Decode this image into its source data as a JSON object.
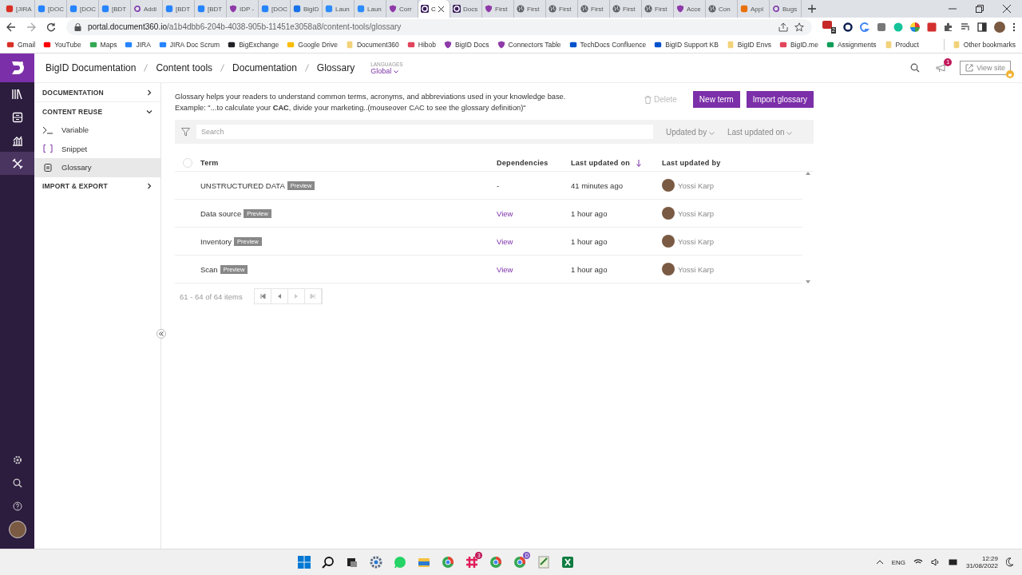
{
  "browser": {
    "tabs": [
      {
        "kind": "gmail",
        "label": "[JIRA",
        "selected": false
      },
      {
        "kind": "jira",
        "label": "[DOC",
        "selected": false
      },
      {
        "kind": "jira",
        "label": "[DOC",
        "selected": false
      },
      {
        "kind": "jira",
        "label": "[BDT",
        "selected": false
      },
      {
        "kind": "ring",
        "label": "Addi",
        "selected": false
      },
      {
        "kind": "jira",
        "label": "[BDT",
        "selected": false
      },
      {
        "kind": "jira",
        "label": "[BDT",
        "selected": false
      },
      {
        "kind": "shield",
        "label": "IDP -",
        "selected": false
      },
      {
        "kind": "jira",
        "label": "[DOC",
        "selected": false
      },
      {
        "kind": "doc",
        "label": "BigID",
        "selected": false
      },
      {
        "kind": "zoom",
        "label": "Laun",
        "selected": false
      },
      {
        "kind": "zoom",
        "label": "Laun",
        "selected": false
      },
      {
        "kind": "shield",
        "label": "Corr",
        "selected": false
      },
      {
        "kind": "d360",
        "label": "C",
        "selected": true
      },
      {
        "kind": "d360",
        "label": "Docs",
        "selected": false
      },
      {
        "kind": "shield",
        "label": "First",
        "selected": false
      },
      {
        "kind": "globe",
        "label": "First",
        "selected": false
      },
      {
        "kind": "globe",
        "label": "First",
        "selected": false
      },
      {
        "kind": "globe",
        "label": "First",
        "selected": false
      },
      {
        "kind": "globe",
        "label": "First",
        "selected": false
      },
      {
        "kind": "globe",
        "label": "First",
        "selected": false
      },
      {
        "kind": "shield",
        "label": "Acce",
        "selected": false
      },
      {
        "kind": "globe",
        "label": "Con",
        "selected": false
      },
      {
        "kind": "app",
        "label": "Appl",
        "selected": false
      },
      {
        "kind": "ring",
        "label": "Bugs",
        "selected": false
      }
    ],
    "url_host": "portal.document360.io",
    "url_path": "/a1b4dbb6-204b-4038-905b-11451e3058a8/content-tools/glossary",
    "extension_badge": "2",
    "bookmarks": [
      {
        "kind": "gmail",
        "label": "Gmail"
      },
      {
        "kind": "youtube",
        "label": "YouTube"
      },
      {
        "kind": "maps",
        "label": "Maps"
      },
      {
        "kind": "jira",
        "label": "JIRA"
      },
      {
        "kind": "jira",
        "label": "JIRA Doc Scrum"
      },
      {
        "kind": "github",
        "label": "BigExchange"
      },
      {
        "kind": "drive",
        "label": "Google Drive"
      },
      {
        "kind": "folder",
        "label": "Document360"
      },
      {
        "kind": "hibob",
        "label": "Hibob"
      },
      {
        "kind": "shield",
        "label": "BigID Docs"
      },
      {
        "kind": "shield",
        "label": "Connectors Table"
      },
      {
        "kind": "confluence",
        "label": "TechDocs Confluence"
      },
      {
        "kind": "confluence",
        "label": "BigID Support KB"
      },
      {
        "kind": "folder",
        "label": "BigID Envs"
      },
      {
        "kind": "dash",
        "label": "BigID.me"
      },
      {
        "kind": "sheet",
        "label": "Assignments"
      },
      {
        "kind": "folder",
        "label": "Product"
      }
    ],
    "other_bookmarks": "Other bookmarks"
  },
  "header": {
    "breadcrumbs": [
      "BigID Documentation",
      "Content tools",
      "Documentation",
      "Glossary"
    ],
    "languages_label": "LANGUAGES",
    "language": "Global",
    "notification_count": "1",
    "view_site": "View site"
  },
  "sidebar": {
    "sections": [
      {
        "label": "DOCUMENTATION",
        "expanded": false
      },
      {
        "label": "CONTENT REUSE",
        "expanded": true,
        "items": [
          {
            "kind": "variable",
            "label": "Variable",
            "selected": false
          },
          {
            "kind": "snippet",
            "label": "Snippet",
            "selected": false
          },
          {
            "kind": "glossary",
            "label": "Glossary",
            "selected": true
          }
        ]
      },
      {
        "label": "IMPORT & EXPORT",
        "expanded": false
      }
    ]
  },
  "intro": [
    "Glossary helps your readers to understand common terms, acronyms, and abbreviations used in your knowledge base.",
    "Example: \"...to calculate your **CAC**, divide your marketing..(mouseover CAC to see the glossary definition)\""
  ],
  "actions": {
    "delete": {
      "label": "Delete",
      "disabled": true
    },
    "new_term": "New term",
    "import": "Import glossary"
  },
  "filters": {
    "search_placeholder": "Search",
    "updated_by": "Updated by",
    "last_updated_on": "Last updated on"
  },
  "table": {
    "select_all_checked": false,
    "columns": [
      {
        "label": "Term",
        "sorted": false
      },
      {
        "label": "Dependencies",
        "sorted": false
      },
      {
        "label": "Last updated on",
        "sorted": true
      },
      {
        "label": "Last updated by",
        "sorted": false
      }
    ],
    "rows": [
      {
        "term": "UNSTRUCTURED DATA",
        "badge": "Preview",
        "dependencies": "-",
        "updated_on": "41 minutes ago",
        "updated_by": "Yossi Karp"
      },
      {
        "term": "Data source",
        "badge": "Preview",
        "dependencies": "View",
        "updated_on": "1 hour ago",
        "updated_by": "Yossi Karp"
      },
      {
        "term": "Inventory",
        "badge": "Preview",
        "dependencies": "View",
        "updated_on": "1 hour ago",
        "updated_by": "Yossi Karp"
      },
      {
        "term": "Scan",
        "badge": "Preview",
        "dependencies": "View",
        "updated_on": "1 hour ago",
        "updated_by": "Yossi Karp"
      }
    ]
  },
  "pagination": {
    "summary": "61 - 64 of 64 items"
  },
  "taskbar": {
    "slack_badge": "3",
    "chrome_badge": "D",
    "language": "ENG",
    "time": "12:29",
    "date": "31/08/2022"
  }
}
